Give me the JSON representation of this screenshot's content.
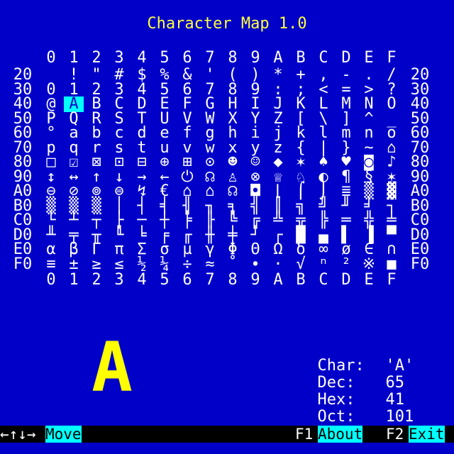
{
  "app": {
    "title": "Character Map 1.0"
  },
  "grid": {
    "column_headers": [
      "0",
      "1",
      "2",
      "3",
      "4",
      "5",
      "6",
      "7",
      "8",
      "9",
      "A",
      "B",
      "C",
      "D",
      "E",
      "F"
    ],
    "row_labels": [
      "20",
      "30",
      "40",
      "50",
      "60",
      "70",
      "80",
      "90",
      "A0",
      "B0",
      "C0",
      "D0",
      "E0",
      "F0"
    ],
    "rows": [
      [
        " ",
        "!",
        "\"",
        "#",
        "$",
        "%",
        "&",
        "'",
        "(",
        ")",
        "*",
        "+",
        ",",
        "-",
        ".",
        "/"
      ],
      [
        "0",
        "1",
        "2",
        "3",
        "4",
        "5",
        "6",
        "7",
        "8",
        "9",
        ":",
        ";",
        "<",
        "=",
        ">",
        "?"
      ],
      [
        "@",
        "A",
        "B",
        "C",
        "D",
        "E",
        "F",
        "G",
        "H",
        "I",
        "J",
        "K",
        "L",
        "M",
        "N",
        "O"
      ],
      [
        "P",
        "Q",
        "R",
        "S",
        "T",
        "U",
        "V",
        "W",
        "X",
        "Y",
        "Z",
        "[",
        "\\",
        "]",
        "^",
        "_"
      ],
      [
        "°",
        "a",
        "b",
        "c",
        "d",
        "e",
        "f",
        "g",
        "h",
        "i",
        "j",
        "k",
        "l",
        "m",
        "n",
        "o"
      ],
      [
        "p",
        "q",
        "r",
        "s",
        "t",
        "u",
        "v",
        "w",
        "x",
        "y",
        "z",
        "{",
        "|",
        "}",
        "~",
        "⌂"
      ],
      [
        "□",
        "☑",
        "⊠",
        "⊡",
        "⊟",
        "⊕",
        "⊞",
        "⊙",
        "☻",
        "☺",
        "◆",
        "✶",
        "♠",
        "♥",
        "◙",
        "♪"
      ],
      [
        "↕",
        "↔",
        "↑",
        "↓",
        "→",
        "←",
        "⏻",
        "☊",
        "♙",
        "⊗",
        "♕",
        "♘",
        "◐",
        "¶",
        "§",
        "✶"
      ],
      [
        "⊖",
        "⊘",
        "⊚",
        "⊜",
        "↯",
        "€",
        "⌂",
        "⌂",
        "☊",
        "◘",
        "⌊",
        "⌠",
        "⌡",
        "≣",
        "▒",
        "▓"
      ],
      [
        "▒",
        "▒",
        "▒",
        "│",
        "┤",
        "╡",
        "╢",
        "╖",
        "╕",
        "╣",
        "║",
        "╗",
        "╝",
        "╜",
        "╛",
        "┐"
      ],
      [
        "└",
        "┴",
        "┬",
        "├",
        "─",
        "┼",
        "╞",
        "╟",
        "╚",
        "╔",
        "╩",
        "╦",
        "╠",
        "═",
        "╬",
        "╧"
      ],
      [
        "╨",
        "╤",
        "╥",
        "╙",
        "╘",
        "╒",
        "╓",
        "╫",
        "╪",
        "┘",
        "┌",
        "█",
        "▄",
        "▌",
        "▐",
        "▀"
      ],
      [
        "α",
        "β",
        "Γ",
        "π",
        "Σ",
        "σ",
        "µ",
        "γ",
        "Φ",
        "Θ",
        "Ω",
        "δ",
        "∞",
        "ø",
        "∈",
        "∩"
      ],
      [
        "≡",
        "±",
        "≥",
        "≤",
        "½",
        "¼",
        "÷",
        "≈",
        "˚",
        "∙",
        "·",
        "√",
        "ⁿ",
        "²",
        "※",
        "■"
      ]
    ],
    "selected": {
      "row": 2,
      "col": 1
    }
  },
  "preview": {
    "char": "A"
  },
  "info": {
    "char_label": "Char:",
    "char_value": "'A'",
    "dec_label": "Dec:",
    "dec_value": "65",
    "hex_label": "Hex:",
    "hex_value": "41",
    "oct_label": "Oct:",
    "oct_value": "101"
  },
  "status_bar": {
    "arrows": "←↑↓→",
    "move_label": "Move",
    "f1_key": "F1",
    "about_label": "About",
    "f2_key": "F2",
    "exit_label": "Exit"
  },
  "colors": {
    "background": "#0000c8",
    "title": "#ffff40",
    "preview": "#ffff00",
    "highlight": "#00ffff",
    "status_bar": "#000000"
  }
}
